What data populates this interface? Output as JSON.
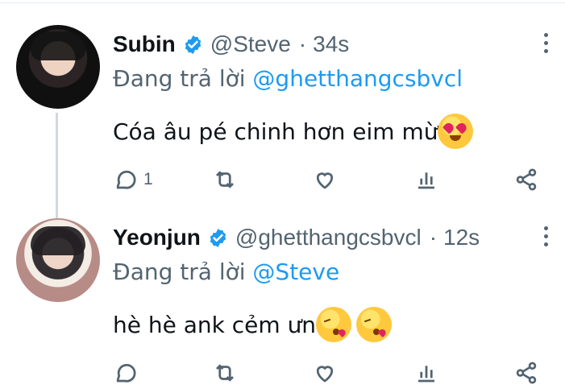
{
  "tweets": [
    {
      "display_name": "Subin",
      "handle": "@Steve",
      "separator": "·",
      "time": "34s",
      "reply_prefix": "Đang trả lời",
      "reply_to": "@ghetthangcsbvcl",
      "text": "Cóa âu pé chinh hơn eim mừ",
      "emoji": [
        "heart-eyes-emoji"
      ],
      "reply_count": "1"
    },
    {
      "display_name": "Yeonjun",
      "handle": "@ghetthangcsbvcl",
      "separator": "·",
      "time": "12s",
      "reply_prefix": "Đang trả lời",
      "reply_to": "@Steve",
      "text": "hè hè ank cẻm ưn",
      "emoji": [
        "kissing-heart-emoji",
        "kissing-heart-emoji"
      ],
      "reply_count": ""
    }
  ],
  "icons": {
    "verified": "verified-badge-icon",
    "more": "more-options-icon",
    "reply": "reply-icon",
    "retweet": "retweet-icon",
    "like": "like-heart-icon",
    "views": "analytics-icon",
    "share": "share-icon"
  },
  "colors": {
    "accent": "#1d9bf0",
    "text": "#0f1419",
    "muted": "#536471",
    "thread_line": "#cfd9de"
  }
}
